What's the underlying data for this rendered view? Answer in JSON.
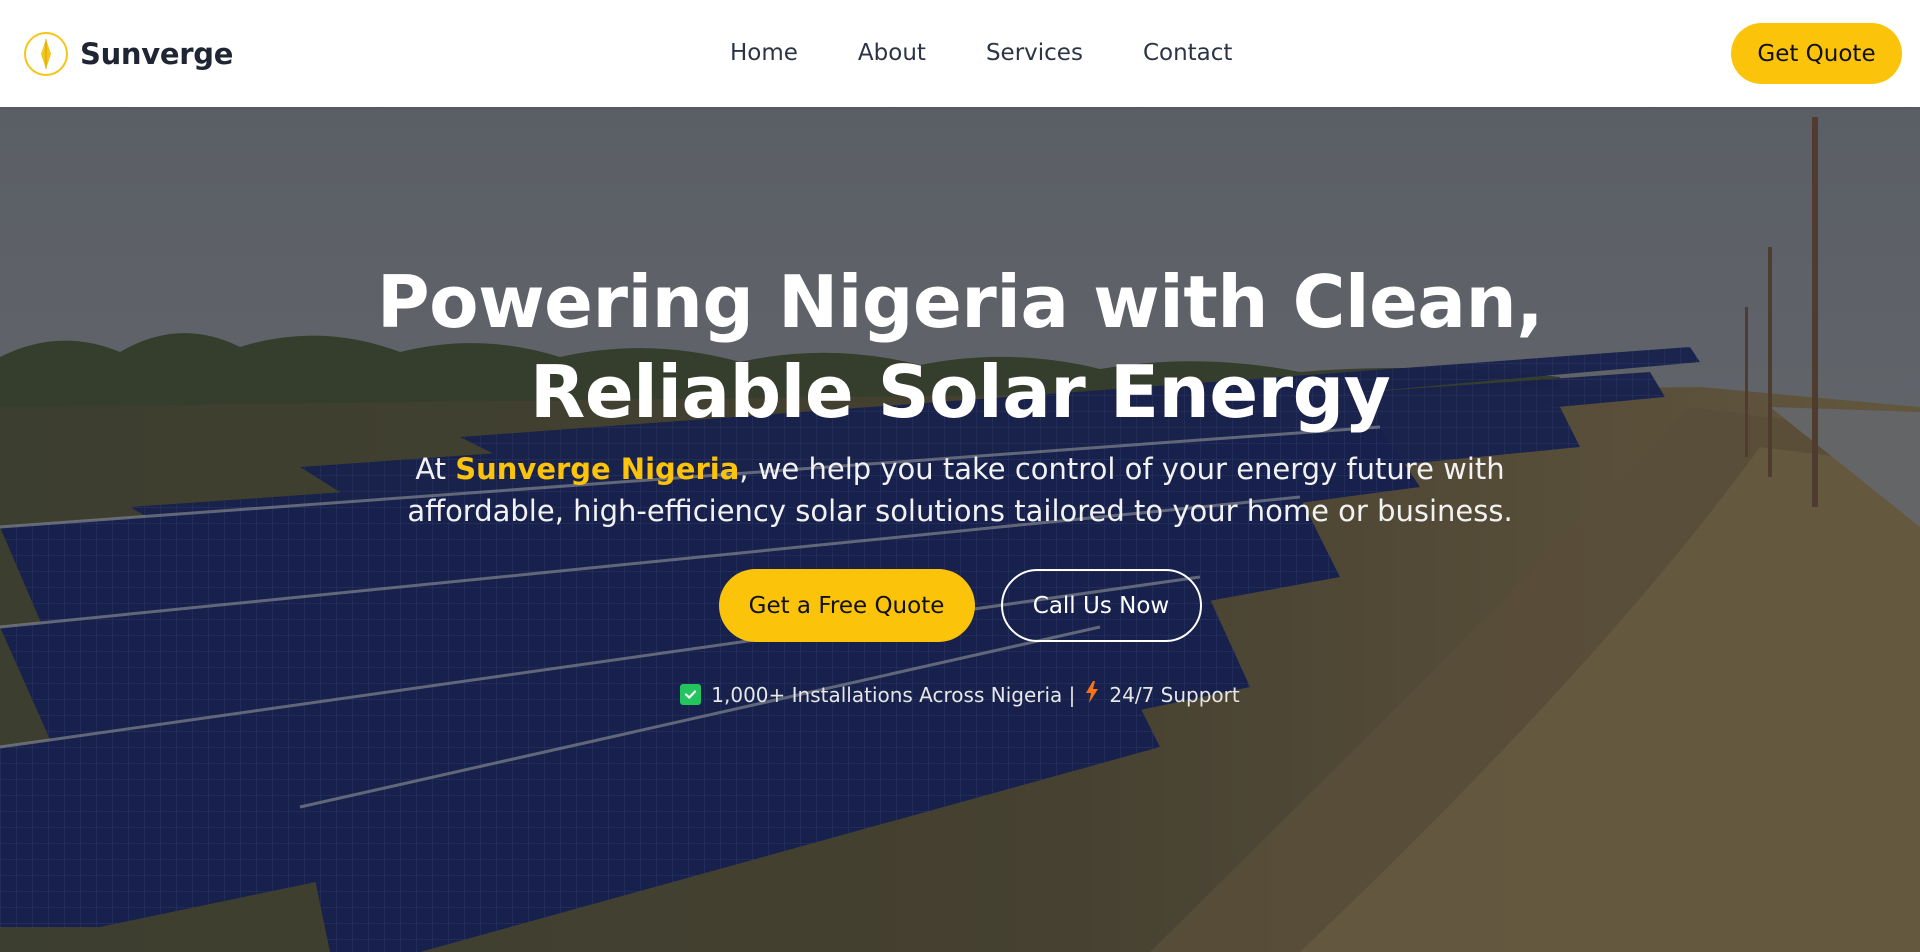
{
  "brand": {
    "name": "Sunverge"
  },
  "nav": {
    "items": [
      "Home",
      "About",
      "Services",
      "Contact"
    ]
  },
  "header": {
    "quote_button": "Get Quote"
  },
  "hero": {
    "title_line1": "Powering Nigeria with Clean,",
    "title_line2": "Reliable Solar Energy",
    "subtitle_prefix": "At ",
    "subtitle_highlight": "Sunverge Nigeria",
    "subtitle_rest1": ", we help you take control of your energy future with",
    "subtitle_rest2": "affordable, high-efficiency solar solutions tailored to your home or business.",
    "cta_primary": "Get a Free Quote",
    "cta_secondary": "Call Us Now",
    "trust_installations": "1,000+ Installations Across Nigeria |",
    "trust_support": "24/7 Support"
  },
  "icons": {
    "logo": "sun-logo-icon",
    "check": "check-icon",
    "bolt": "lightning-icon"
  },
  "colors": {
    "accent": "#fcc30b",
    "text_dark": "#1f2533",
    "check_green": "#22c55e",
    "bolt_orange": "#f97316"
  }
}
